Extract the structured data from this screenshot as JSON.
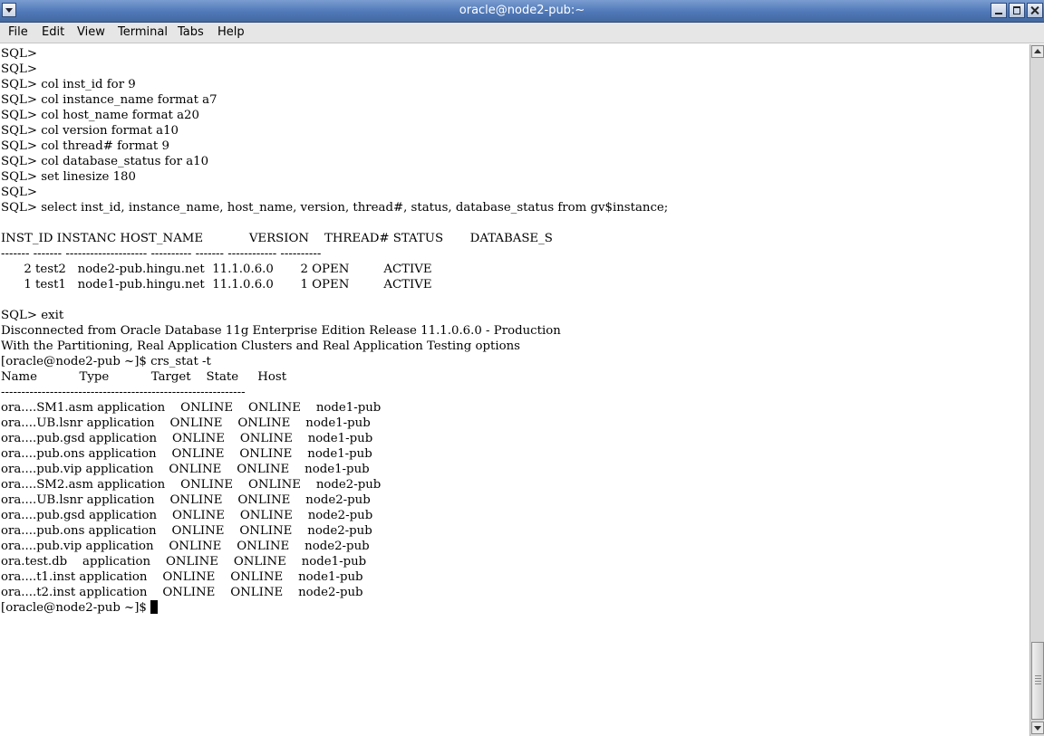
{
  "window": {
    "title": "oracle@node2-pub:~"
  },
  "menu": {
    "file": "File",
    "edit": "Edit",
    "view": "View",
    "terminal": "Terminal",
    "tabs": "Tabs",
    "help": "Help"
  },
  "terminal": {
    "lines": [
      "SQL>",
      "SQL>",
      "SQL> col inst_id for 9",
      "SQL> col instance_name format a7",
      "SQL> col host_name format a20",
      "SQL> col version format a10",
      "SQL> col thread# format 9",
      "SQL> col database_status for a10",
      "SQL> set linesize 180",
      "SQL>",
      "SQL> select inst_id, instance_name, host_name, version, thread#, status, database_status from gv$instance;",
      "",
      "INST_ID INSTANC HOST_NAME            VERSION    THREAD# STATUS       DATABASE_S",
      "------- ------- -------------------- ---------- ------- ------------ ----------",
      "      2 test2   node2-pub.hingu.net  11.1.0.6.0       2 OPEN         ACTIVE",
      "      1 test1   node1-pub.hingu.net  11.1.0.6.0       1 OPEN         ACTIVE",
      "",
      "SQL> exit",
      "Disconnected from Oracle Database 11g Enterprise Edition Release 11.1.0.6.0 - Production",
      "With the Partitioning, Real Application Clusters and Real Application Testing options",
      "[oracle@node2-pub ~]$ crs_stat -t",
      "Name           Type           Target    State     Host",
      "------------------------------------------------------------",
      "ora....SM1.asm application    ONLINE    ONLINE    node1-pub",
      "ora....UB.lsnr application    ONLINE    ONLINE    node1-pub",
      "ora....pub.gsd application    ONLINE    ONLINE    node1-pub",
      "ora....pub.ons application    ONLINE    ONLINE    node1-pub",
      "ora....pub.vip application    ONLINE    ONLINE    node1-pub",
      "ora....SM2.asm application    ONLINE    ONLINE    node2-pub",
      "ora....UB.lsnr application    ONLINE    ONLINE    node2-pub",
      "ora....pub.gsd application    ONLINE    ONLINE    node2-pub",
      "ora....pub.ons application    ONLINE    ONLINE    node2-pub",
      "ora....pub.vip application    ONLINE    ONLINE    node2-pub",
      "ora.test.db    application    ONLINE    ONLINE    node1-pub",
      "ora....t1.inst application    ONLINE    ONLINE    node1-pub",
      "ora....t2.inst application    ONLINE    ONLINE    node2-pub"
    ],
    "prompt": "[oracle@node2-pub ~]$ "
  }
}
